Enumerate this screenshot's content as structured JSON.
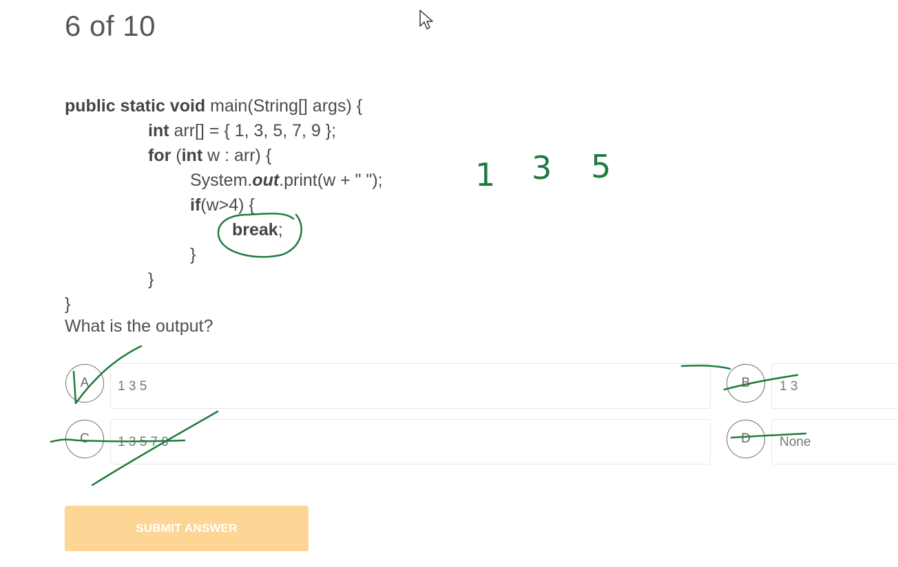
{
  "progress": "6 of 10",
  "code": {
    "l1": {
      "kw": "public static void",
      "rest": " main(String[] args) {"
    },
    "l2": {
      "kw": "int",
      "rest": " arr[] = { 1, 3, 5, 7, 9 };"
    },
    "l3": {
      "kw1": "for",
      "mid1": " (",
      "kw2": "int",
      "rest": " w : arr) {"
    },
    "l4": {
      "pre": "System.",
      "em": "out",
      "rest": ".print(w + \" \");"
    },
    "l5": {
      "kw": "if",
      "rest": "(w>4) {"
    },
    "l6": {
      "kw": "break",
      "rest": ";"
    },
    "l7": "}",
    "l8": "}",
    "l9": "}"
  },
  "question": "What is the output?",
  "options": [
    {
      "letter": "A",
      "text": "1 3 5"
    },
    {
      "letter": "B",
      "text": "1 3"
    },
    {
      "letter": "C",
      "text": "1 3 5 7 9"
    },
    {
      "letter": "D",
      "text": "None"
    }
  ],
  "annotations": {
    "n1": "1",
    "n2": "3",
    "n3": "5",
    "ink_color": "#1e7a3c"
  },
  "submit_label": "SUBMIT ANSWER",
  "colors": {
    "submit_bg": "#fdd595",
    "text": "#4a4a4a"
  }
}
